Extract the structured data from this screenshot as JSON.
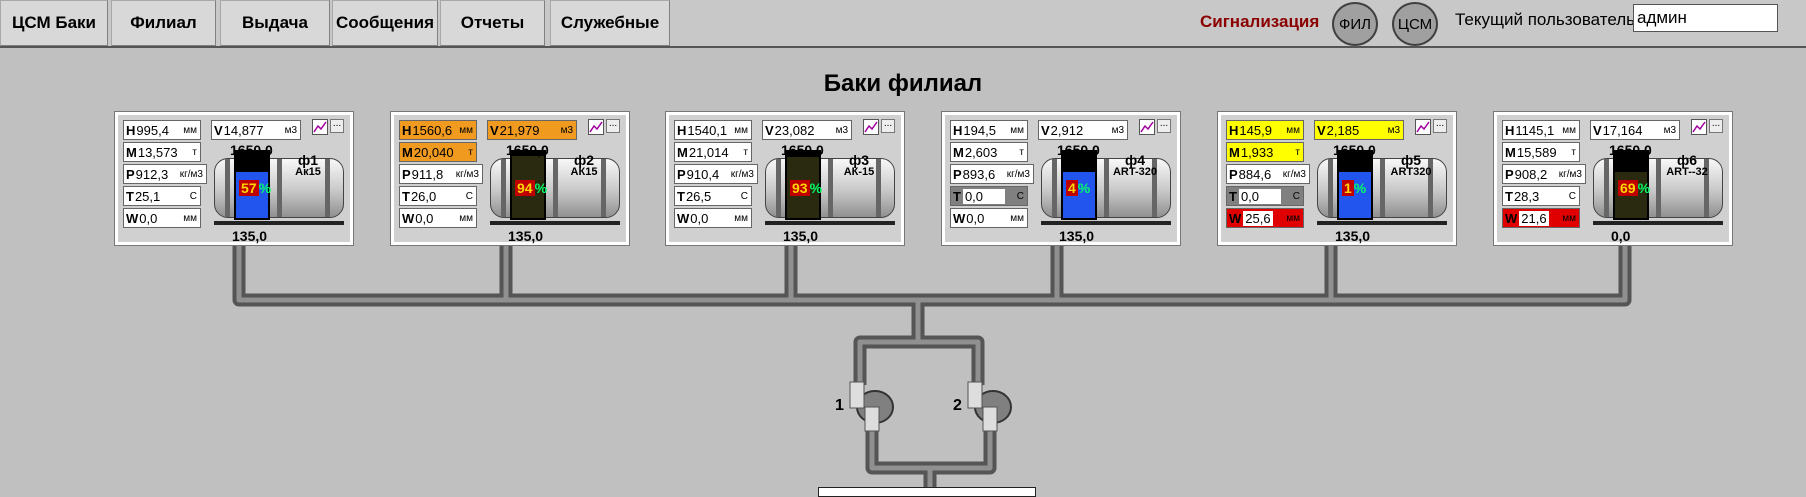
{
  "nav": {
    "items": [
      {
        "label": "ЦСМ Баки"
      },
      {
        "label": "Филиал"
      },
      {
        "label": "Выдача"
      },
      {
        "label": "Сообщения"
      },
      {
        "label": "Отчеты"
      },
      {
        "label": "Служебные"
      }
    ]
  },
  "header": {
    "alarm_label": "Сигнализация",
    "fil_button": "ФИЛ",
    "csm_button": "ЦСМ",
    "user_label": "Текущий пользователь:",
    "user_value": "админ"
  },
  "page_title": "Баки филиал",
  "colors": {
    "alarm_text": "#8b0000",
    "warn_orange": "#f09a20",
    "warn_yellow": "#ffff00",
    "alarm_red": "#e00000",
    "level_blue": "#2255ee",
    "level_dark": "#2a2a10"
  },
  "tanks": [
    {
      "name": "ф1",
      "code": "Ак15",
      "capacity": "1650,0",
      "bottom": "135,0",
      "percent": "57",
      "pct_sign": "%",
      "level_color": "#2255ee",
      "fill_fraction": 0.57,
      "H": {
        "label": "H",
        "value": "995,4",
        "unit": "мм",
        "state": "normal"
      },
      "V": {
        "label": "V",
        "value": "14,877",
        "unit": "м3",
        "state": "normal"
      },
      "M": {
        "label": "M",
        "value": "13,573",
        "unit": "т",
        "state": "normal"
      },
      "P": {
        "label": "P",
        "value": "912,3",
        "unit": "кг/м3",
        "state": "normal"
      },
      "T": {
        "label": "T",
        "value": "25,1",
        "unit": "С",
        "state": "normal"
      },
      "W": {
        "label": "W",
        "value": "0,0",
        "unit": "мм",
        "state": "normal"
      }
    },
    {
      "name": "ф2",
      "code": "АК15",
      "capacity": "1650,0",
      "bottom": "135,0",
      "percent": "94",
      "pct_sign": "%",
      "level_color": "#2a2a10",
      "fill_fraction": 0.94,
      "H": {
        "label": "H",
        "value": "1560,6",
        "unit": "мм",
        "state": "orange"
      },
      "V": {
        "label": "V",
        "value": "21,979",
        "unit": "м3",
        "state": "orange"
      },
      "M": {
        "label": "M",
        "value": "20,040",
        "unit": "т",
        "state": "orange"
      },
      "P": {
        "label": "P",
        "value": "911,8",
        "unit": "кг/м3",
        "state": "normal"
      },
      "T": {
        "label": "T",
        "value": "26,0",
        "unit": "С",
        "state": "normal"
      },
      "W": {
        "label": "W",
        "value": "0,0",
        "unit": "мм",
        "state": "normal"
      }
    },
    {
      "name": "ф3",
      "code": "АК-15",
      "capacity": "1650,0",
      "bottom": "135,0",
      "percent": "93",
      "pct_sign": "%",
      "level_color": "#2a2a10",
      "fill_fraction": 0.93,
      "H": {
        "label": "H",
        "value": "1540,1",
        "unit": "мм",
        "state": "normal"
      },
      "V": {
        "label": "V",
        "value": "23,082",
        "unit": "м3",
        "state": "normal"
      },
      "M": {
        "label": "M",
        "value": "21,014",
        "unit": "т",
        "state": "normal"
      },
      "P": {
        "label": "P",
        "value": "910,4",
        "unit": "кг/м3",
        "state": "normal"
      },
      "T": {
        "label": "T",
        "value": "26,5",
        "unit": "С",
        "state": "normal"
      },
      "W": {
        "label": "W",
        "value": "0,0",
        "unit": "мм",
        "state": "normal"
      }
    },
    {
      "name": "ф4",
      "code": "ART-320",
      "capacity": "1650,0",
      "bottom": "135,0",
      "percent": "4",
      "pct_sign": "%",
      "level_color": "#2255ee",
      "fill_fraction": 0.04,
      "H": {
        "label": "H",
        "value": "194,5",
        "unit": "мм",
        "state": "normal"
      },
      "V": {
        "label": "V",
        "value": "2,912",
        "unit": "м3",
        "state": "normal"
      },
      "M": {
        "label": "M",
        "value": "2,603",
        "unit": "т",
        "state": "normal"
      },
      "P": {
        "label": "P",
        "value": "893,6",
        "unit": "кг/м3",
        "state": "normal"
      },
      "T": {
        "label": "T",
        "value": "0,0",
        "unit": "С",
        "state": "grey"
      },
      "W": {
        "label": "W",
        "value": "0,0",
        "unit": "мм",
        "state": "normal"
      }
    },
    {
      "name": "ф5",
      "code": "ART320",
      "capacity": "1650,0",
      "bottom": "135,0",
      "percent": "1",
      "pct_sign": "%",
      "level_color": "#2255ee",
      "fill_fraction": 0.01,
      "H": {
        "label": "H",
        "value": "145,9",
        "unit": "мм",
        "state": "yellow"
      },
      "V": {
        "label": "V",
        "value": "2,185",
        "unit": "м3",
        "state": "yellow"
      },
      "M": {
        "label": "M",
        "value": "1,933",
        "unit": "т",
        "state": "yellow"
      },
      "P": {
        "label": "P",
        "value": "884,6",
        "unit": "кг/м3",
        "state": "normal"
      },
      "T": {
        "label": "T",
        "value": "0,0",
        "unit": "С",
        "state": "grey"
      },
      "W": {
        "label": "W",
        "value": "25,6",
        "unit": "мм",
        "state": "red"
      }
    },
    {
      "name": "ф6",
      "code": "ART--32",
      "capacity": "1650,0",
      "bottom": "0,0",
      "percent": "69",
      "pct_sign": "%",
      "level_color": "#2a2a10",
      "fill_fraction": 0.69,
      "H": {
        "label": "H",
        "value": "1145,1",
        "unit": "мм",
        "state": "normal"
      },
      "V": {
        "label": "V",
        "value": "17,164",
        "unit": "м3",
        "state": "normal"
      },
      "M": {
        "label": "M",
        "value": "15,589",
        "unit": "т",
        "state": "normal"
      },
      "P": {
        "label": "P",
        "value": "908,2",
        "unit": "кг/м3",
        "state": "normal"
      },
      "T": {
        "label": "T",
        "value": "28,3",
        "unit": "С",
        "state": "normal"
      },
      "W": {
        "label": "W",
        "value": "21,6",
        "unit": "мм",
        "state": "red"
      }
    }
  ],
  "pumps": [
    {
      "label": "1"
    },
    {
      "label": "2"
    }
  ]
}
